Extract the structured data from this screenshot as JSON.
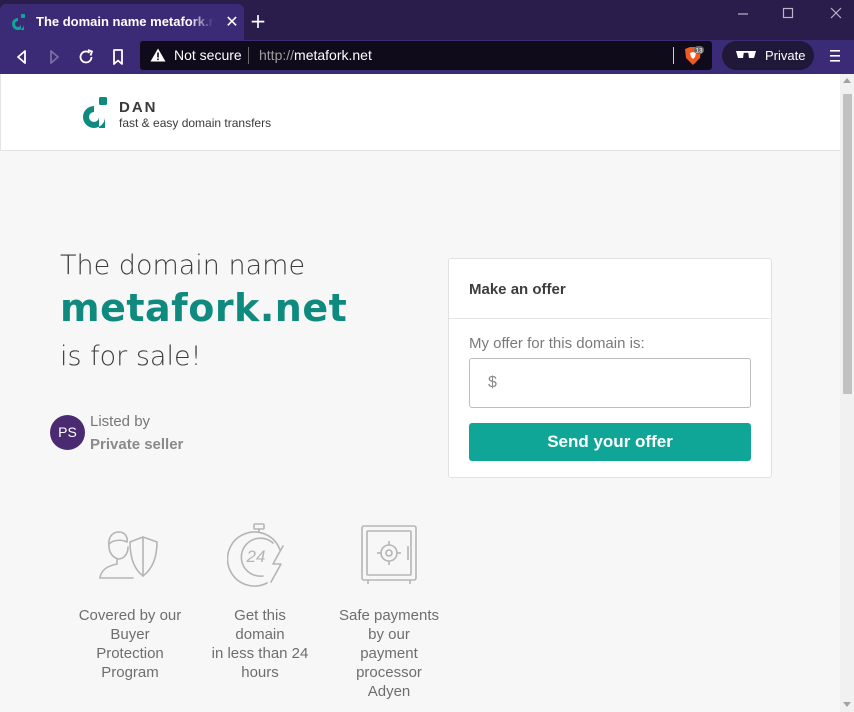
{
  "browser": {
    "tab_title": "The domain name metafork.net is for sale",
    "tab_close": "✕",
    "new_tab": "+",
    "url_security": "Not secure",
    "url_scheme": "http://",
    "url_host": "metafork.net",
    "shields_count": "13",
    "private_label": "Private",
    "colors": {
      "titlebar": "#2a1d4c",
      "toolbar": "#3b2a76",
      "brave_orange": "#f05a22"
    }
  },
  "header": {
    "logo_name": "DAN",
    "tagline": "fast & easy domain transfers",
    "logo_color": "#0f8a7e"
  },
  "hero": {
    "line1": "The domain name",
    "domain": "metafork.net",
    "line2": "is for sale!"
  },
  "seller": {
    "initials": "PS",
    "listed_by": "Listed by",
    "name": "Private seller"
  },
  "offer": {
    "title": "Make an offer",
    "label": "My offer for this domain is:",
    "currency": "$",
    "input_value": "",
    "button": "Send your offer",
    "button_color": "#10a697"
  },
  "features": [
    {
      "icon": "buyer-protection-icon",
      "text": "Covered by our\nBuyer\nProtection\nProgram"
    },
    {
      "icon": "24-hours-icon",
      "text": "Get this\ndomain\nin less than 24\nhours"
    },
    {
      "icon": "safe-icon",
      "text": "Safe payments\nby our\npayment\nprocessor\nAdyen"
    }
  ]
}
